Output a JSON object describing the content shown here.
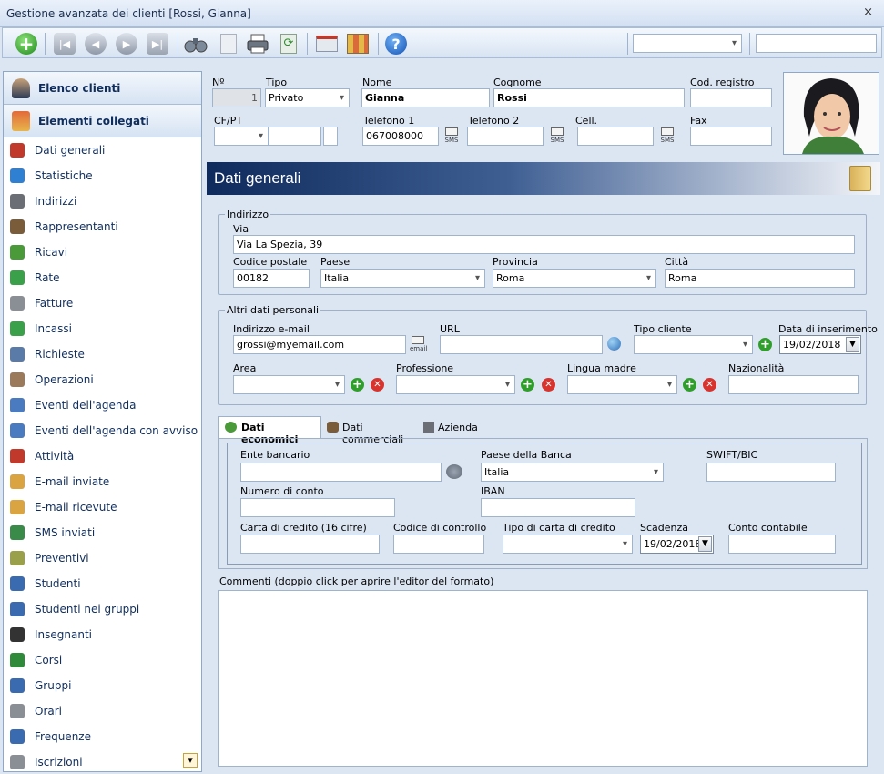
{
  "window": {
    "title": "Gestione avanzata dei clienti [Rossi, Gianna]",
    "close": "×"
  },
  "toolbar": {
    "select_value": "",
    "search_value": ""
  },
  "sidebar": {
    "headers": [
      {
        "label": "Elenco clienti",
        "icon": "person-icon"
      },
      {
        "label": "Elementi collegati",
        "icon": "linked-items-icon"
      }
    ],
    "items": [
      {
        "label": "Dati generali",
        "icon": "general-data-icon",
        "color": "#c0392b"
      },
      {
        "label": "Statistiche",
        "icon": "pie-chart-icon",
        "color": "#2f7fd3"
      },
      {
        "label": "Indirizzi",
        "icon": "building-icon",
        "color": "#6b6f75"
      },
      {
        "label": "Rappresentanti",
        "icon": "people-icon",
        "color": "#7a5c3a"
      },
      {
        "label": "Ricavi",
        "icon": "money-icon",
        "color": "#4a9a3a"
      },
      {
        "label": "Rate",
        "icon": "installments-icon",
        "color": "#3aa04a"
      },
      {
        "label": "Fatture",
        "icon": "invoice-icon",
        "color": "#8a8f96"
      },
      {
        "label": "Incassi",
        "icon": "receipt-icon",
        "color": "#3aa04a"
      },
      {
        "label": "Richieste",
        "icon": "request-icon",
        "color": "#5a7aa8"
      },
      {
        "label": "Operazioni",
        "icon": "operations-icon",
        "color": "#9a7a5a"
      },
      {
        "label": "Eventi dell'agenda",
        "icon": "calendar-icon",
        "color": "#4a7ac0"
      },
      {
        "label": "Eventi dell'agenda con avviso",
        "icon": "calendar-alert-icon",
        "color": "#4a7ac0"
      },
      {
        "label": "Attività",
        "icon": "task-icon",
        "color": "#c0392b"
      },
      {
        "label": "E-mail inviate",
        "icon": "email-sent-icon",
        "color": "#d9a441"
      },
      {
        "label": "E-mail ricevute",
        "icon": "email-received-icon",
        "color": "#d9a441"
      },
      {
        "label": "SMS inviati",
        "icon": "sms-icon",
        "color": "#3a8a4a"
      },
      {
        "label": "Preventivi",
        "icon": "quote-icon",
        "color": "#9aa04a"
      },
      {
        "label": "Studenti",
        "icon": "student-icon",
        "color": "#3a6ab0"
      },
      {
        "label": "Studenti nei gruppi",
        "icon": "student-group-icon",
        "color": "#3a6ab0"
      },
      {
        "label": "Insegnanti",
        "icon": "teacher-icon",
        "color": "#333333"
      },
      {
        "label": "Corsi",
        "icon": "course-icon",
        "color": "#2f8a3a"
      },
      {
        "label": "Gruppi",
        "icon": "groups-icon",
        "color": "#3a6ab0"
      },
      {
        "label": "Orari",
        "icon": "schedule-icon",
        "color": "#8a8f96"
      },
      {
        "label": "Frequenze",
        "icon": "attendance-icon",
        "color": "#3a6ab0"
      },
      {
        "label": "Iscrizioni",
        "icon": "enrollment-icon",
        "color": "#8a8f96"
      }
    ],
    "scroll_glyph": "▾"
  },
  "header": {
    "num_label": "Nº",
    "num_value": "1",
    "tipo_label": "Tipo",
    "tipo_value": "Privato",
    "nome_label": "Nome",
    "nome_value": "Gianna",
    "cognome_label": "Cognome",
    "cognome_value": "Rossi",
    "codreg_label": "Cod. registro",
    "codreg_value": "",
    "cfpt_label": "CF/PT",
    "tel1_label": "Telefono 1",
    "tel1_value": "067008000",
    "tel2_label": "Telefono 2",
    "tel2_value": "",
    "cell_label": "Cell.",
    "cell_value": "",
    "fax_label": "Fax",
    "fax_value": "",
    "sms": "SMS"
  },
  "section": {
    "title": "Dati generali"
  },
  "indirizzo": {
    "legend": "Indirizzo",
    "via_label": "Via",
    "via_value": "Via La Spezia, 39",
    "cap_label": "Codice postale",
    "cap_value": "00182",
    "paese_label": "Paese",
    "paese_value": "Italia",
    "provincia_label": "Provincia",
    "provincia_value": "Roma",
    "citta_label": "Città",
    "citta_value": "Roma"
  },
  "altri": {
    "legend": "Altri dati personali",
    "email_label": "Indirizzo e-mail",
    "email_value": "grossi@myemail.com",
    "email_icon": "email",
    "url_label": "URL",
    "url_value": "",
    "tipocliente_label": "Tipo cliente",
    "tipocliente_value": "",
    "data_label": "Data di inserimento",
    "data_value": "19/02/2018",
    "area_label": "Area",
    "area_value": "",
    "professione_label": "Professione",
    "professione_value": "",
    "lingua_label": "Lingua madre",
    "lingua_value": "",
    "naz_label": "Nazionalità",
    "naz_value": ""
  },
  "tabs": [
    {
      "label": "Dati economici",
      "icon": "money-icon",
      "active": true
    },
    {
      "label": "Dati commerciali",
      "icon": "people-icon",
      "active": false
    },
    {
      "label": "Azienda",
      "icon": "building-icon",
      "active": false
    }
  ],
  "economici": {
    "ente_label": "Ente bancario",
    "ente_value": "",
    "paesebanca_label": "Paese della Banca",
    "paesebanca_value": "Italia",
    "swift_label": "SWIFT/BIC",
    "swift_value": "",
    "conto_label": "Numero di conto",
    "conto_value": "",
    "iban_label": "IBAN",
    "iban_value": "",
    "carta_label": "Carta di credito (16 cifre)",
    "carta_value": "",
    "codctrl_label": "Codice di controllo",
    "codctrl_value": "",
    "tipocarta_label": "Tipo di carta di credito",
    "tipocarta_value": "",
    "scad_label": "Scadenza",
    "scad_value": "19/02/2018",
    "contocont_label": "Conto contabile",
    "contocont_value": ""
  },
  "commenti": {
    "label": "Commenti (doppio click per aprire l'editor del formato)",
    "value": ""
  },
  "colors": {
    "accent": "#102e5c",
    "banner_start": "#0f2a5c",
    "banner_end": "#f3f5f9",
    "add": "#2f9e2a",
    "remove": "#d8332c"
  }
}
